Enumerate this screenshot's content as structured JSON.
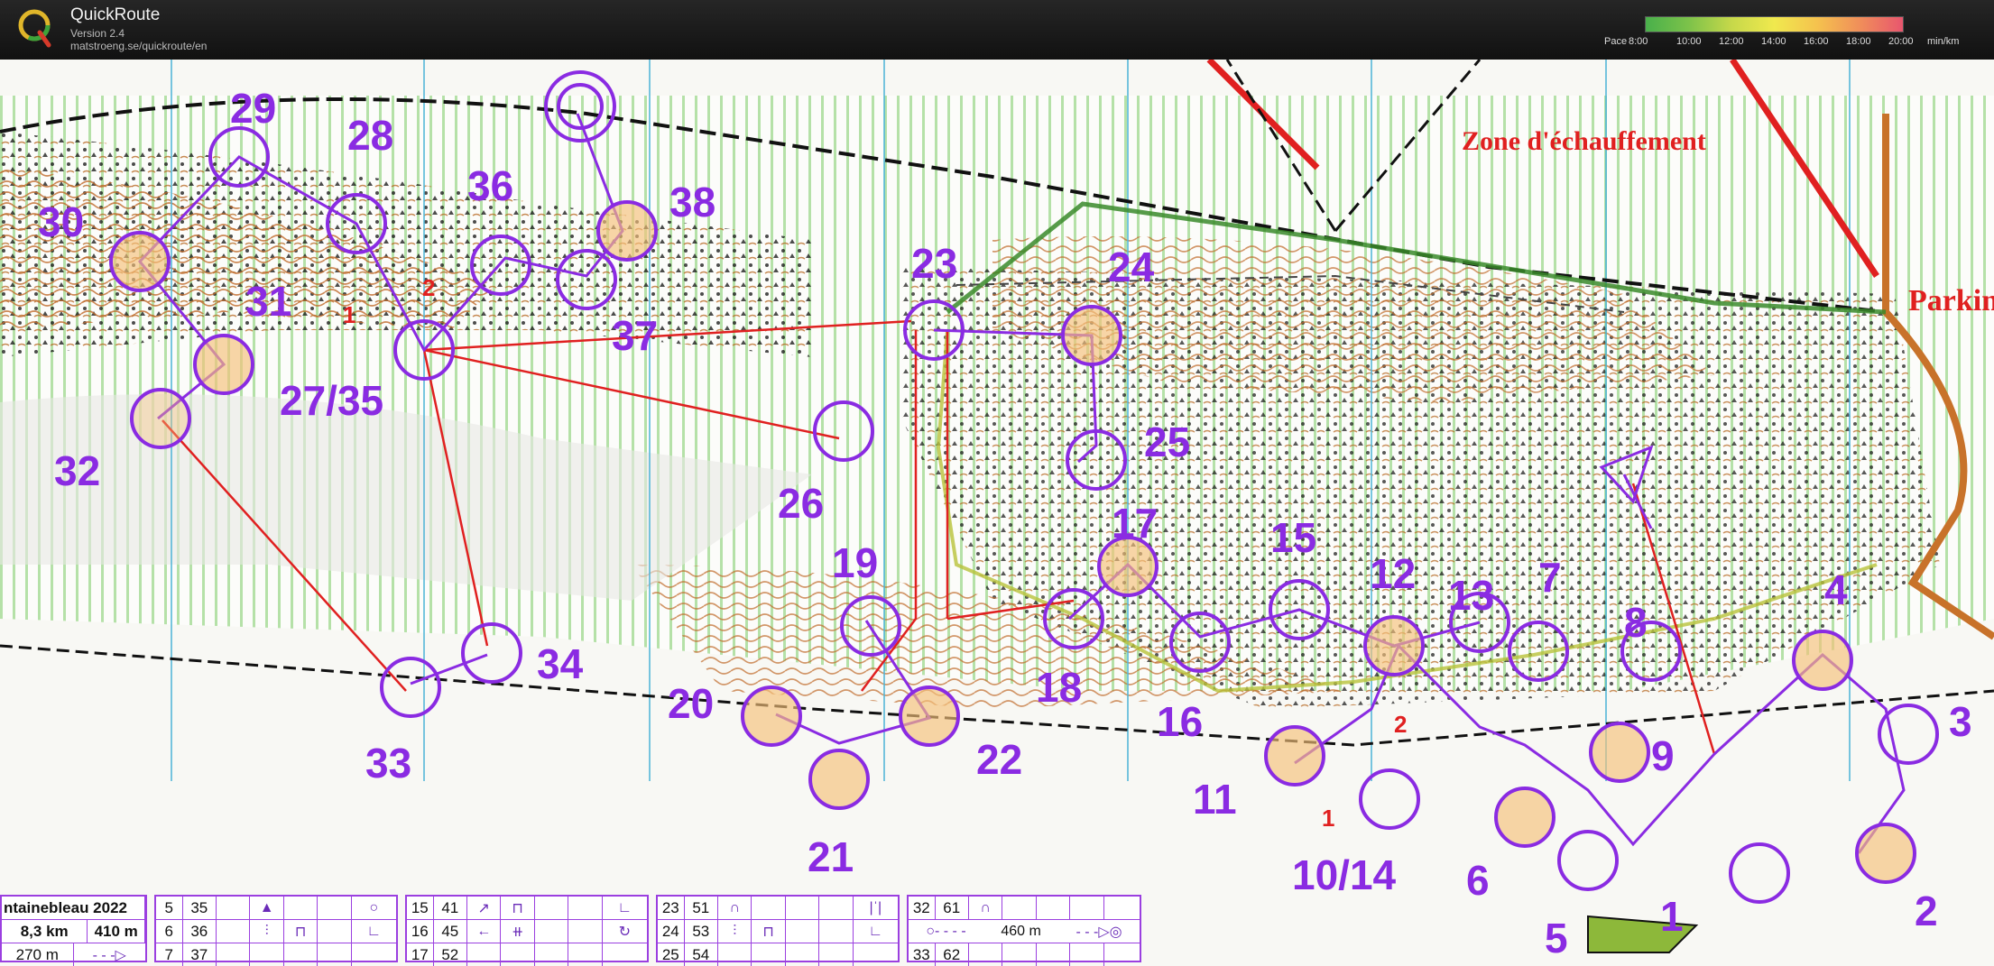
{
  "app": {
    "title": "QuickRoute",
    "version": "Version 2.4",
    "url": "matstroeng.se/quickroute/en"
  },
  "pace_scale": {
    "label": "Pace",
    "unit": "min/km",
    "ticks": [
      "8:00",
      "10:00",
      "12:00",
      "14:00",
      "16:00",
      "18:00",
      "20:00"
    ],
    "colors": [
      "#49b04b",
      "#c6d84a",
      "#f0e94e",
      "#f08e5a",
      "#e8566e"
    ]
  },
  "map": {
    "zone_label": "Zone d'échauffement",
    "parking_label": "Parking",
    "colors": {
      "course": "#8a2be2",
      "leg": "#e02020",
      "route": "#3a8a2a",
      "forest": "#7fcf6a"
    },
    "controls": [
      {
        "label": "1"
      },
      {
        "label": "2"
      },
      {
        "label": "3"
      },
      {
        "label": "4"
      },
      {
        "label": "5"
      },
      {
        "label": "6"
      },
      {
        "label": "7"
      },
      {
        "label": "8"
      },
      {
        "label": "9"
      },
      {
        "label": "10/14"
      },
      {
        "label": "11"
      },
      {
        "label": "12"
      },
      {
        "label": "13"
      },
      {
        "label": "15"
      },
      {
        "label": "16"
      },
      {
        "label": "17"
      },
      {
        "label": "18"
      },
      {
        "label": "19"
      },
      {
        "label": "20"
      },
      {
        "label": "21"
      },
      {
        "label": "22"
      },
      {
        "label": "23"
      },
      {
        "label": "24"
      },
      {
        "label": "25"
      },
      {
        "label": "26"
      },
      {
        "label": "27/35"
      },
      {
        "label": "28"
      },
      {
        "label": "29"
      },
      {
        "label": "30"
      },
      {
        "label": "31"
      },
      {
        "label": "32"
      },
      {
        "label": "33"
      },
      {
        "label": "34"
      },
      {
        "label": "36"
      },
      {
        "label": "37"
      },
      {
        "label": "38"
      }
    ],
    "markers": [
      "1",
      "2",
      "1",
      "2"
    ]
  },
  "description_sheet": {
    "event": "ntainebleau 2022",
    "length": "8,3 km",
    "climb": "410 m",
    "partial_row": "270 m",
    "col1": [
      [
        "5",
        "35"
      ],
      [
        "6",
        "36"
      ],
      [
        "7",
        "37"
      ]
    ],
    "col2": [
      [
        "15",
        "41"
      ],
      [
        "16",
        "45"
      ],
      [
        "17",
        "52"
      ]
    ],
    "col3": [
      [
        "23",
        "51"
      ],
      [
        "24",
        "53"
      ],
      [
        "25",
        "54"
      ]
    ],
    "col4": [
      [
        "32",
        "61"
      ],
      [
        "33",
        "62"
      ]
    ],
    "finish_distance": "460 m"
  }
}
